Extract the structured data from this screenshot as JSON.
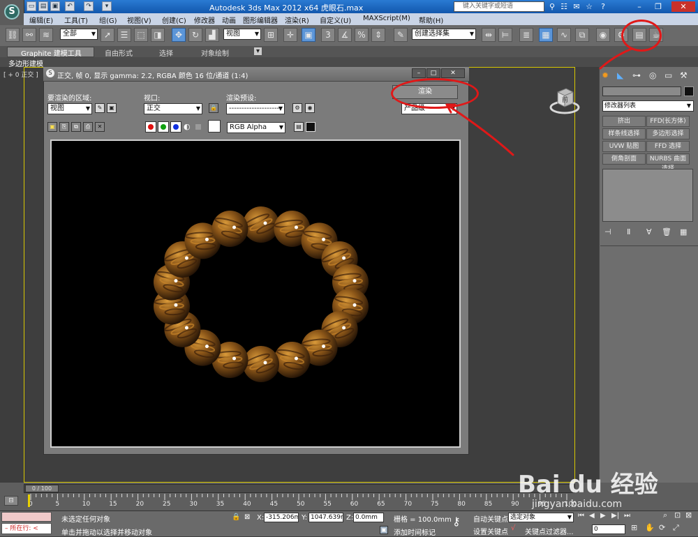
{
  "titlebar": {
    "title": "Autodesk 3ds Max  2012 x64      虎眼石.max",
    "search_placeholder": "键入关键字或短语",
    "help": "?"
  },
  "menu": [
    "编辑(E)",
    "工具(T)",
    "组(G)",
    "视图(V)",
    "创建(C)",
    "修改器",
    "动画",
    "图形编辑器",
    "渲染(R)",
    "自定义(U)",
    "MAXScript(M)",
    "帮助(H)"
  ],
  "toolbar": {
    "selection_filter": "全部",
    "ref_coord": "视图",
    "named_selection": "创建选择集",
    "snap_label": "3"
  },
  "ribbon": {
    "tabs": [
      "Graphite 建模工具",
      "自由形式",
      "选择",
      "对象绘制"
    ],
    "sub": "多边形建模"
  },
  "viewport": {
    "label": "[ + 0 正交 ]",
    "viewcube_face": "前"
  },
  "command_panel": {
    "modifier_list": "修改器列表",
    "buttons": [
      "挤出",
      "FFD(长方体)",
      "样条线选择",
      "多边形选择",
      "UVW 贴图",
      "FFD 选择",
      "倒角剖面",
      "NURBS 曲面选择"
    ]
  },
  "render_window": {
    "title": "正交, 帧 0, 显示 gamma: 2.2, RGBA 颜色 16 位/通道 (1:4)",
    "area_label": "要渲染的区域:",
    "area_value": "视图",
    "viewport_label": "视口:",
    "viewport_value": "正交",
    "preset_label": "渲染预设:",
    "preset_value": "--------------------",
    "render_button": "渲染",
    "quality_value": "产品级",
    "channel_value": "RGB Alpha",
    "channel_colors": [
      "#e01010",
      "#10a010",
      "#1030e0"
    ]
  },
  "timeline": {
    "frame_label": "0 / 100",
    "ticks": [
      "0",
      "5",
      "10",
      "15",
      "20",
      "25",
      "30",
      "35",
      "40",
      "45",
      "50",
      "55",
      "60",
      "65",
      "70",
      "75",
      "80",
      "85",
      "90",
      "95",
      "100"
    ]
  },
  "status": {
    "maxscript_label": "所在行:",
    "prompt_top": "未选定任何对象",
    "prompt_bottom": "单击并拖动以选择并移动对象",
    "x_label": "X:",
    "x_value": "-315.206m",
    "y_label": "Y:",
    "y_value": "1047.639m",
    "z_label": "Z:",
    "z_value": "0.0mm",
    "grid": "栅格 = 100.0mm",
    "add_time_tag": "添加时间标记",
    "auto_key": "自动关键点",
    "selected_obj": "选定对象",
    "set_key": "设置关键点",
    "key_filters": "关键点过滤器...",
    "frame": "0"
  },
  "watermark": {
    "brand": "Bai du 经验",
    "url": "jingyan.baidu.com"
  },
  "colors": {
    "annotation": "#e01818",
    "bead_dark": "#3a200a",
    "bead_light": "#c8852a"
  }
}
